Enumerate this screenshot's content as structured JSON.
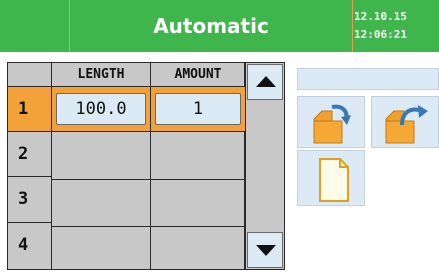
{
  "header": {
    "title": "Automatic",
    "date": "12.10.15",
    "time": "12:06:21",
    "bg_color": "#3fb64b"
  },
  "table": {
    "headers": [
      "LENGTH",
      "AMOUNT"
    ],
    "selected_row_color": "#f3a23a",
    "rows": [
      {
        "num": "1",
        "length": "100.0",
        "amount": "1"
      },
      {
        "num": "2",
        "length": "",
        "amount": ""
      },
      {
        "num": "3",
        "length": "",
        "amount": ""
      },
      {
        "num": "4",
        "length": "",
        "amount": ""
      }
    ]
  },
  "scrollbar": {
    "up_icon": "triangle-up-icon",
    "down_icon": "triangle-down-icon"
  },
  "icons": [
    "folder-open-arrow-icon",
    "folder-save-arrow-icon",
    "new-document-icon"
  ]
}
